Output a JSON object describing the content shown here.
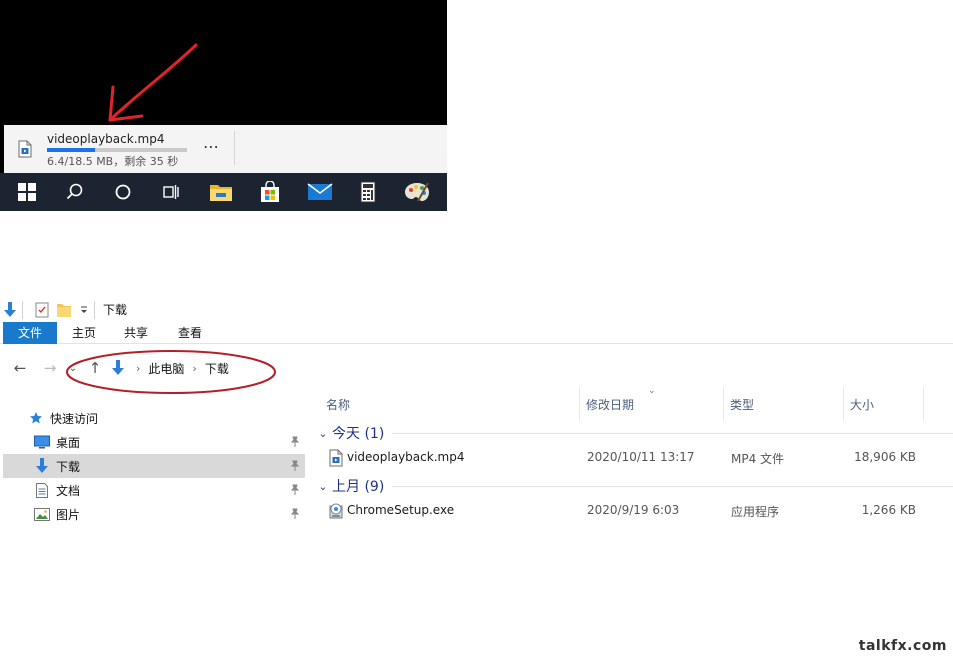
{
  "download": {
    "filename": "videoplayback.mp4",
    "status": "6.4/18.5 MB，剩余 35 秒",
    "progress_fraction": 0.346,
    "more_label": "⋯",
    "file_icon": "video-file-icon",
    "more_icon": "more-options-icon"
  },
  "taskbar": {
    "items": [
      {
        "icon": "windows-start-icon"
      },
      {
        "icon": "search-icon"
      },
      {
        "icon": "cortana-icon"
      },
      {
        "icon": "task-view-icon"
      },
      {
        "icon": "file-explorer-icon"
      },
      {
        "icon": "microsoft-store-icon"
      },
      {
        "icon": "mail-icon"
      },
      {
        "icon": "calculator-icon"
      },
      {
        "icon": "paint-icon"
      }
    ],
    "background": "#1c2431"
  },
  "explorer": {
    "title": "下载",
    "ribbon_tabs": [
      "文件",
      "主页",
      "共享",
      "查看"
    ],
    "breadcrumb": [
      "此电脑",
      "下载"
    ],
    "nav_pane": [
      {
        "label": "快速访问",
        "icon": "star-icon",
        "pinned": false,
        "selected": false
      },
      {
        "label": "桌面",
        "icon": "desktop-icon",
        "pinned": true,
        "selected": false
      },
      {
        "label": "下载",
        "icon": "download-icon",
        "pinned": true,
        "selected": true
      },
      {
        "label": "文档",
        "icon": "document-icon",
        "pinned": true,
        "selected": false
      },
      {
        "label": "图片",
        "icon": "pictures-icon",
        "pinned": true,
        "selected": false
      }
    ],
    "columns": [
      "名称",
      "修改日期",
      "类型",
      "大小"
    ],
    "groups": [
      {
        "label": "今天 (1)",
        "files": [
          {
            "name": "videoplayback.mp4",
            "modified": "2020/10/11 13:17",
            "type": "MP4 文件",
            "size": "18,906 KB",
            "icon": "video-file-icon"
          }
        ]
      },
      {
        "label": "上月 (9)",
        "files": [
          {
            "name": "ChromeSetup.exe",
            "modified": "2020/9/19 6:03",
            "type": "应用程序",
            "size": "1,266 KB",
            "icon": "installer-icon"
          }
        ]
      }
    ],
    "accent": "#1979ca",
    "selected_bg": "#d9d9d9"
  },
  "annotations": {
    "arrow_color": "#e0242b",
    "ellipse_color": "#b3202a"
  },
  "watermark": "talkfx.com"
}
